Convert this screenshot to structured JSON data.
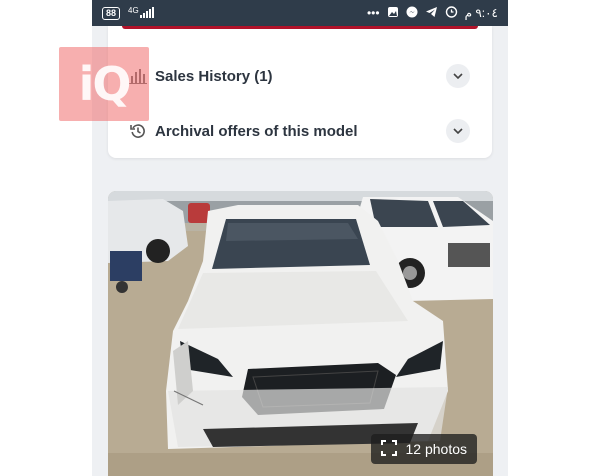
{
  "statusbar": {
    "battery": "88",
    "network": "4G",
    "time": "٩:٠٤ م",
    "icons": [
      "more-dots-icon",
      "gallery-icon",
      "messenger-icon",
      "telegram-icon",
      "alarm-icon"
    ]
  },
  "accordion": {
    "items": [
      {
        "label": "Sales History (1)",
        "icon": "bar-chart-icon",
        "expanded": false
      },
      {
        "label": "Archival offers of this model",
        "icon": "history-icon",
        "expanded": false
      }
    ]
  },
  "photo": {
    "badge_label": "12 photos",
    "badge_icon": "fullscreen-icon"
  },
  "watermark": {
    "text": "iQ"
  },
  "colors": {
    "accent": "#b1122a",
    "statusbar": "#2f3c4a",
    "text": "#2d3540"
  }
}
